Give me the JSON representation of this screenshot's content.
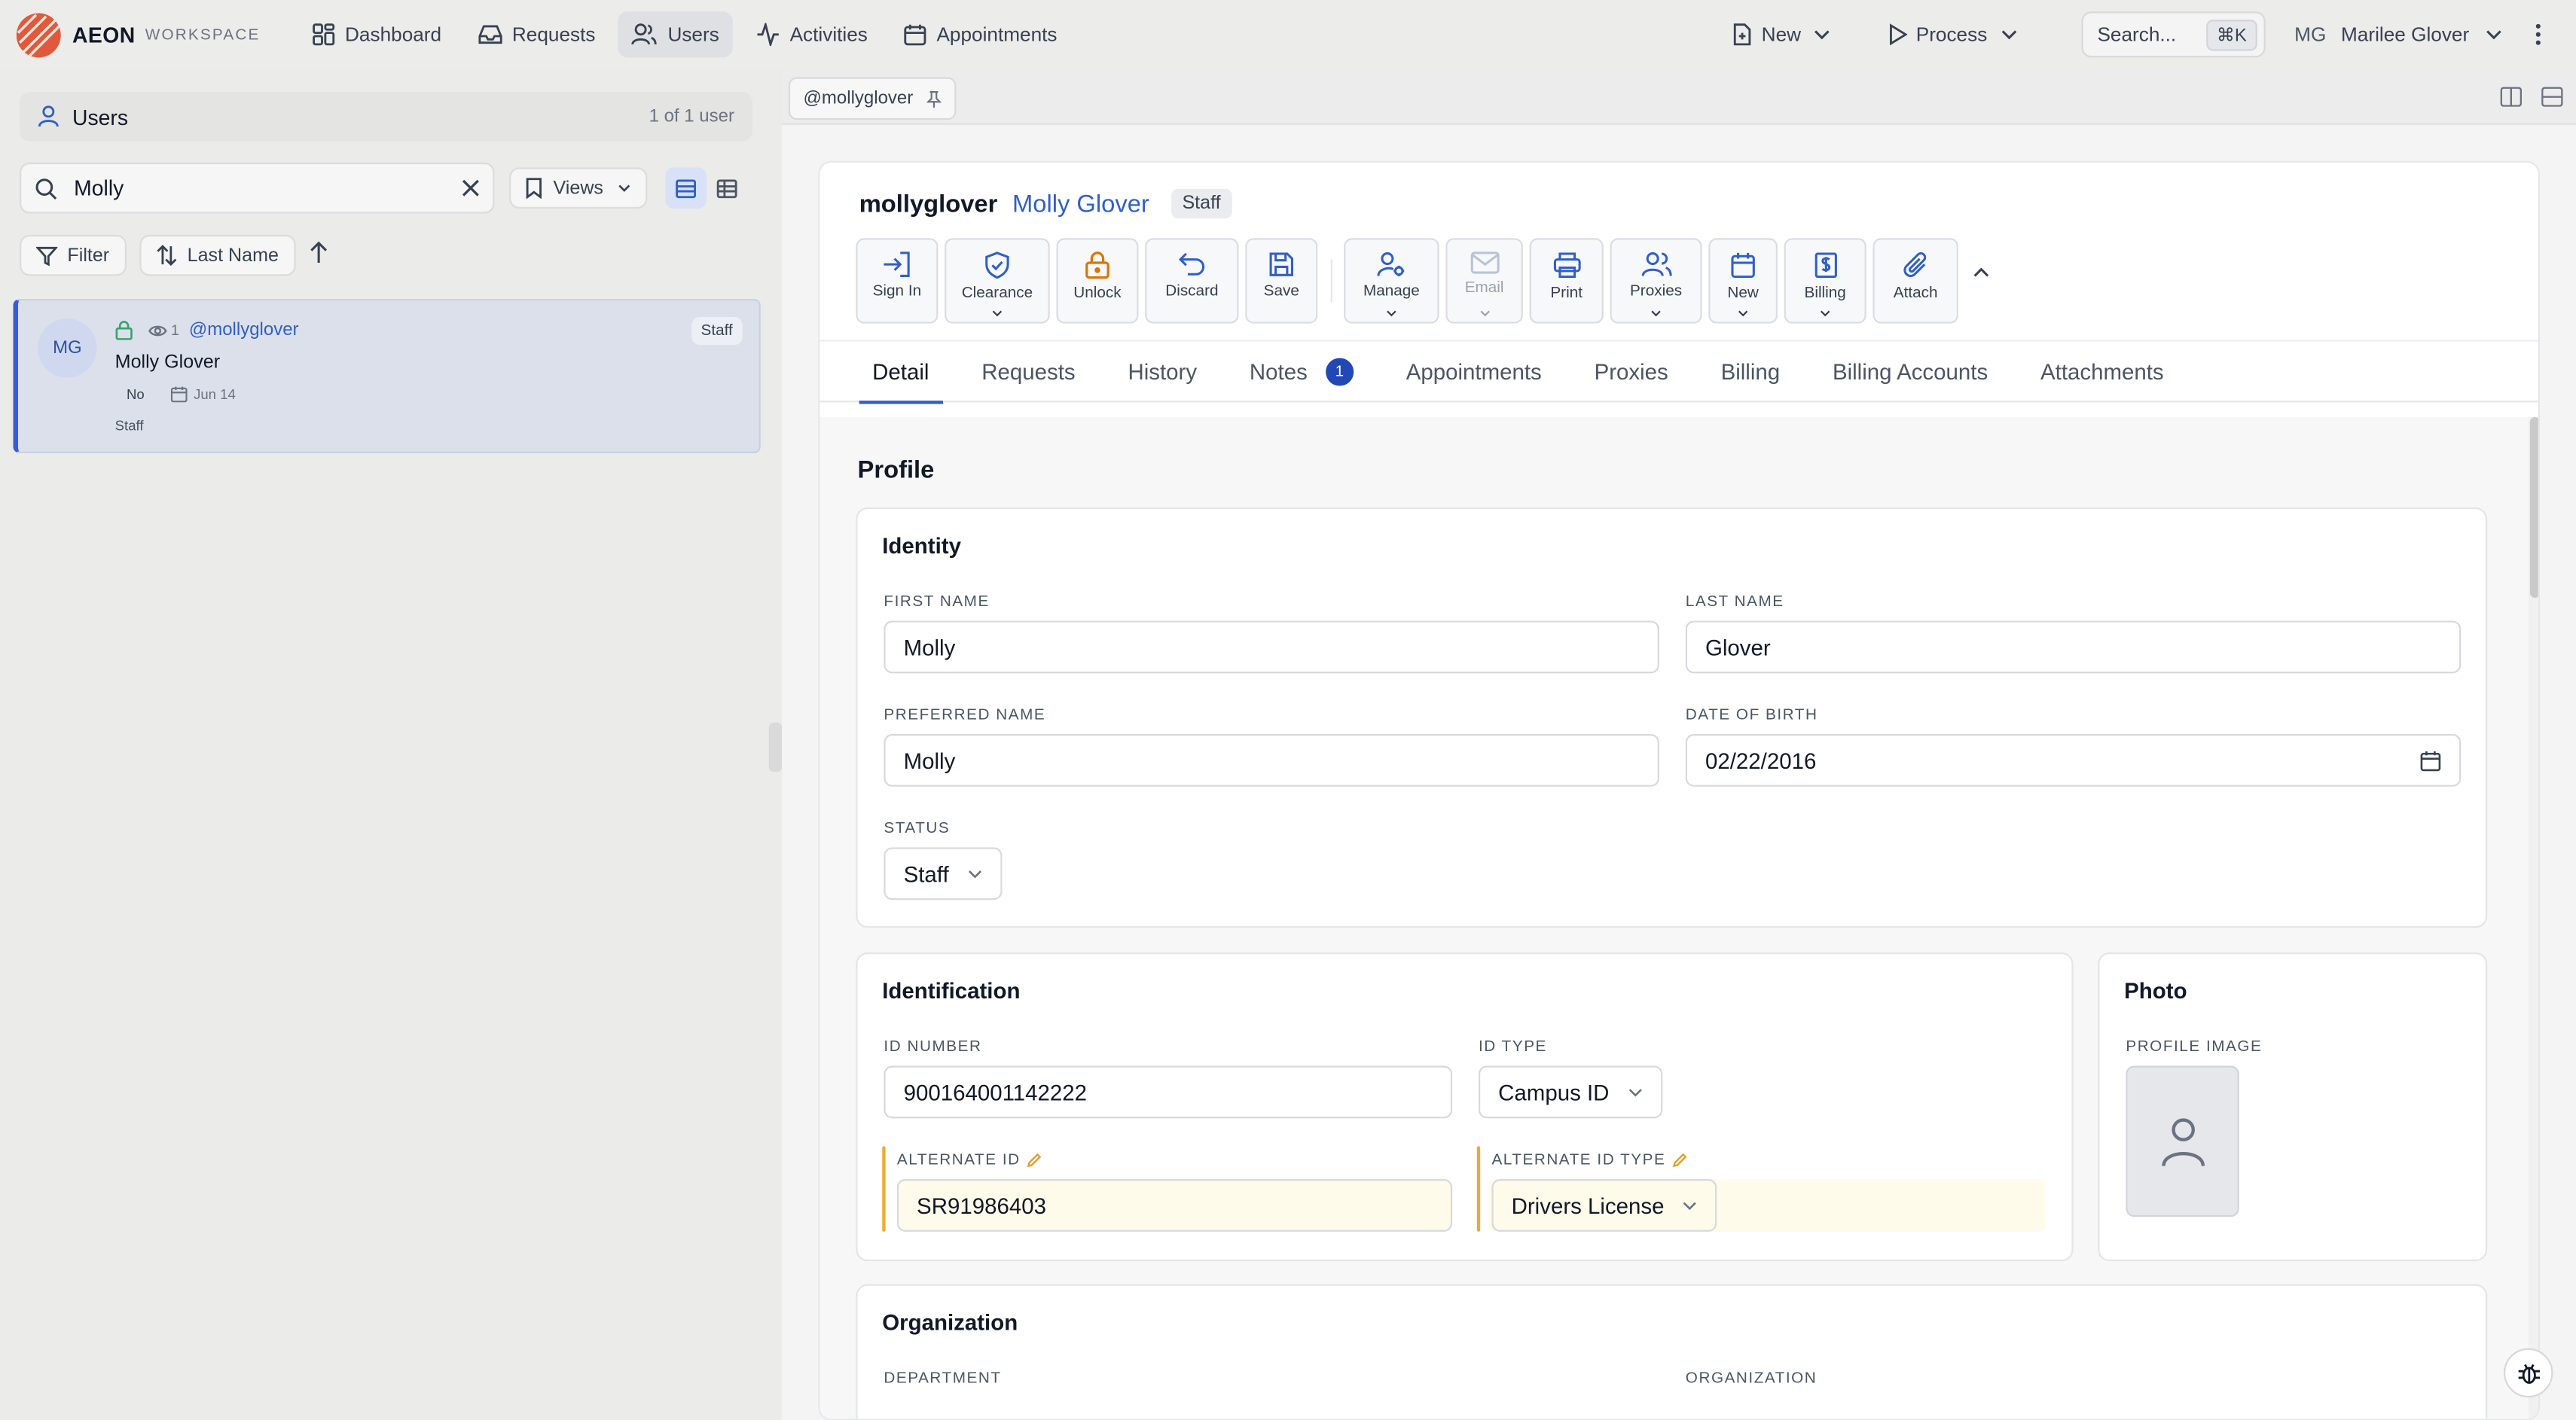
{
  "app": {
    "brand": "AEON",
    "brand_sub": "WORKSPACE",
    "accent": "#2f5fc7",
    "logo_color": "#e0593a"
  },
  "nav": {
    "items": [
      {
        "label": "Dashboard",
        "icon": "dashboard-icon"
      },
      {
        "label": "Requests",
        "icon": "inbox-icon"
      },
      {
        "label": "Users",
        "icon": "users-icon",
        "active": true
      },
      {
        "label": "Activities",
        "icon": "activity-icon"
      },
      {
        "label": "Appointments",
        "icon": "calendar-icon"
      }
    ],
    "new_label": "New",
    "process_label": "Process",
    "search_label": "Search...",
    "search_kbd": "⌘K",
    "user_initials": "MG",
    "user_name": "Marilee Glover"
  },
  "left": {
    "title": "Users",
    "count": "1 of 1 user",
    "search_value": "Molly",
    "views_label": "Views",
    "filter_label": "Filter",
    "sort_label": "Last Name",
    "result": {
      "initials": "MG",
      "watchers": "1",
      "handle": "@mollyglover",
      "name": "Molly Glover",
      "flag": "No",
      "date": "Jun 14",
      "role": "Staff",
      "badge": "Staff"
    }
  },
  "right": {
    "doc_tab": "@mollyglover",
    "username": "mollyglover",
    "full_name": "Molly Glover",
    "role_badge": "Staff",
    "actions": [
      {
        "label": "Sign In",
        "icon": "sign-in-icon"
      },
      {
        "label": "Clearance",
        "icon": "shield-check-icon",
        "caret": true
      },
      {
        "label": "Unlock",
        "icon": "lock-icon"
      },
      {
        "label": "Discard",
        "icon": "undo-icon"
      },
      {
        "label": "Save",
        "icon": "save-icon"
      },
      {
        "label": "Manage",
        "icon": "user-gear-icon",
        "caret": true
      },
      {
        "label": "Email",
        "icon": "mail-icon",
        "caret": true,
        "disabled": true
      },
      {
        "label": "Print",
        "icon": "printer-icon"
      },
      {
        "label": "Proxies",
        "icon": "users-icon",
        "caret": true
      },
      {
        "label": "New",
        "icon": "calendar-icon",
        "caret": true
      },
      {
        "label": "Billing",
        "icon": "invoice-icon",
        "caret": true
      },
      {
        "label": "Attach",
        "icon": "paperclip-icon"
      }
    ],
    "tabs": [
      "Detail",
      "Requests",
      "History",
      "Notes",
      "Appointments",
      "Proxies",
      "Billing",
      "Billing Accounts",
      "Attachments"
    ],
    "notes_count": "1",
    "profile": {
      "title": "Profile",
      "identity": {
        "title": "Identity",
        "first_name_label": "FIRST NAME",
        "first_name": "Molly",
        "last_name_label": "LAST NAME",
        "last_name": "Glover",
        "preferred_label": "PREFERRED NAME",
        "preferred": "Molly",
        "dob_label": "DATE OF BIRTH",
        "dob": "02/22/2016",
        "status_label": "STATUS",
        "status": "Staff"
      },
      "identification": {
        "title": "Identification",
        "id_number_label": "ID NUMBER",
        "id_number": "900164001142222",
        "id_type_label": "ID TYPE",
        "id_type": "Campus ID",
        "alt_id_label": "ALTERNATE ID",
        "alt_id": "SR91986403",
        "alt_id_type_label": "ALTERNATE ID TYPE",
        "alt_id_type": "Drivers License"
      },
      "photo": {
        "title": "Photo",
        "label": "PROFILE IMAGE"
      },
      "organization": {
        "title": "Organization",
        "department_label": "DEPARTMENT",
        "organization_label": "ORGANIZATION"
      }
    }
  }
}
